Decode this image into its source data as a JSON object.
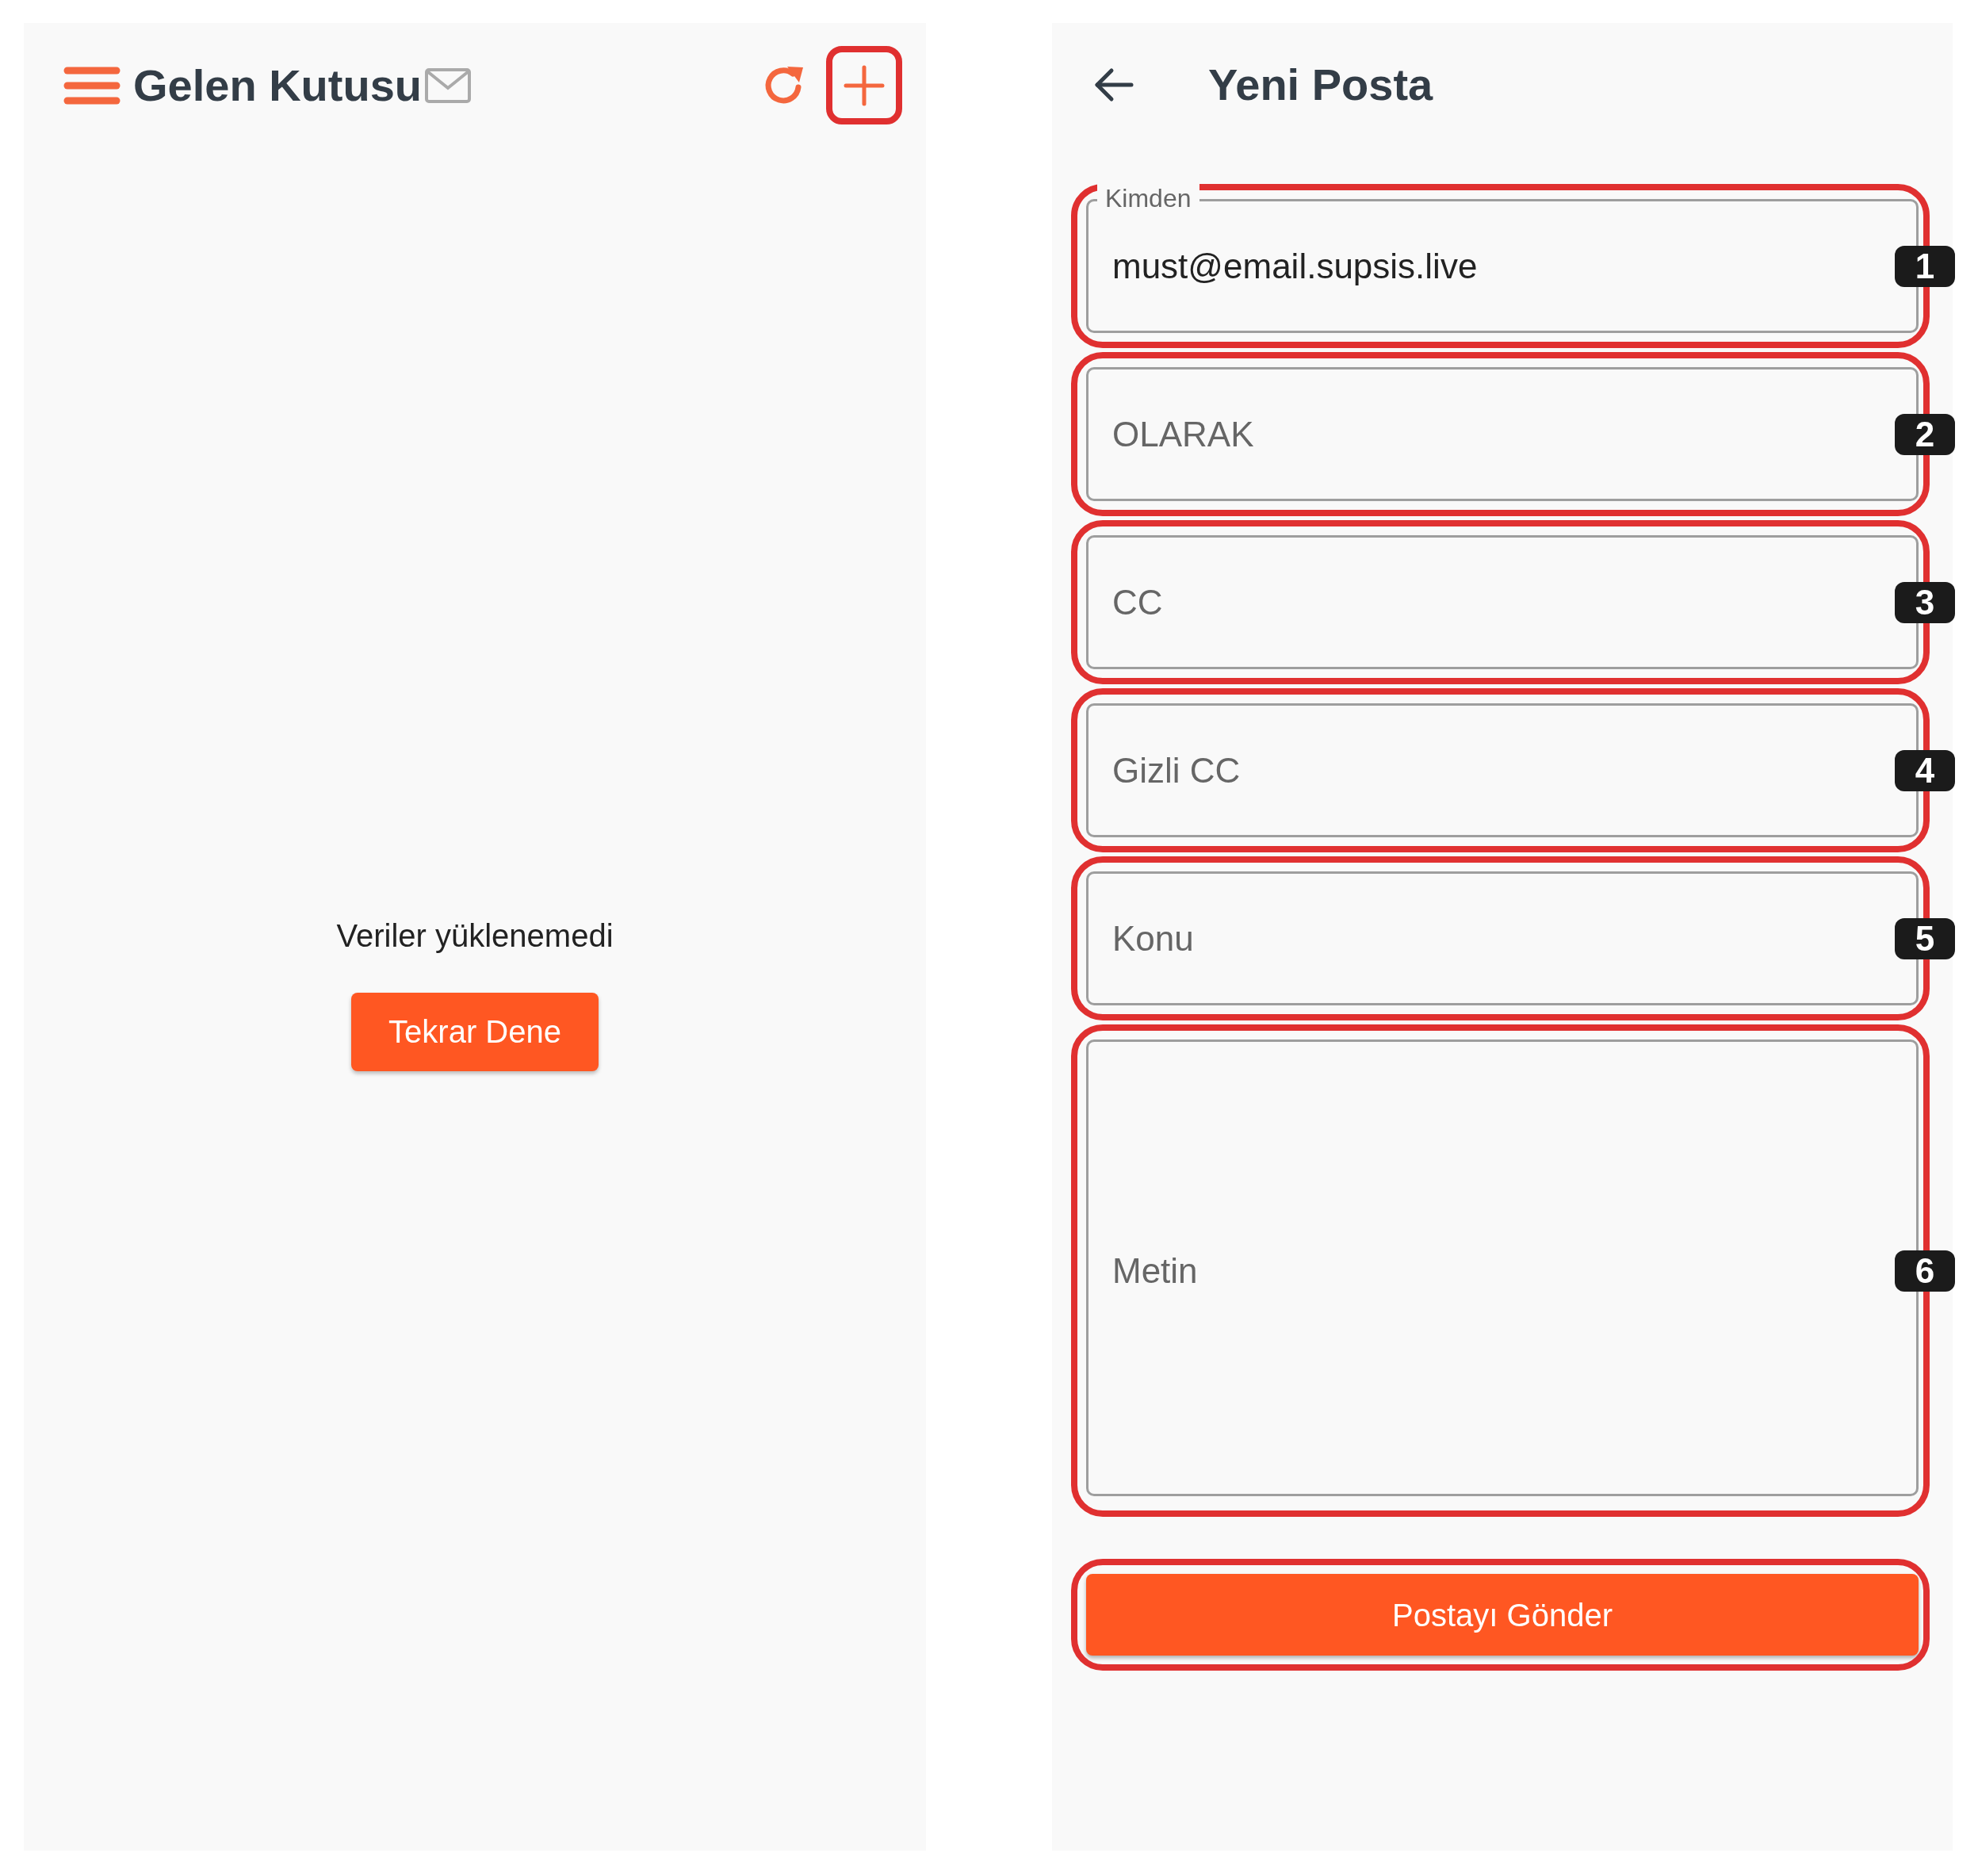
{
  "inbox": {
    "title": "Gelen Kutusu",
    "message": "Veriler yüklenemedi",
    "retry_button": "Tekrar Dene",
    "compose_highlighted": true
  },
  "compose": {
    "title": "Yeni Posta",
    "fields": [
      {
        "kind": "input",
        "label": "Kimden",
        "value": "must@email.supsis.live",
        "highlighted": true,
        "badge": "1"
      },
      {
        "kind": "input",
        "placeholder": "OLARAK",
        "highlighted": true,
        "badge": "2"
      },
      {
        "kind": "input",
        "placeholder": "CC",
        "highlighted": true,
        "badge": "3"
      },
      {
        "kind": "input",
        "placeholder": "Gizli CC",
        "highlighted": true,
        "badge": "4"
      },
      {
        "kind": "input",
        "placeholder": "Konu",
        "highlighted": true,
        "badge": "5"
      },
      {
        "kind": "textarea",
        "placeholder": "Metin",
        "highlighted": true,
        "badge": "6"
      }
    ],
    "send_button": {
      "label": "Postayı Gönder",
      "highlighted": true
    }
  }
}
